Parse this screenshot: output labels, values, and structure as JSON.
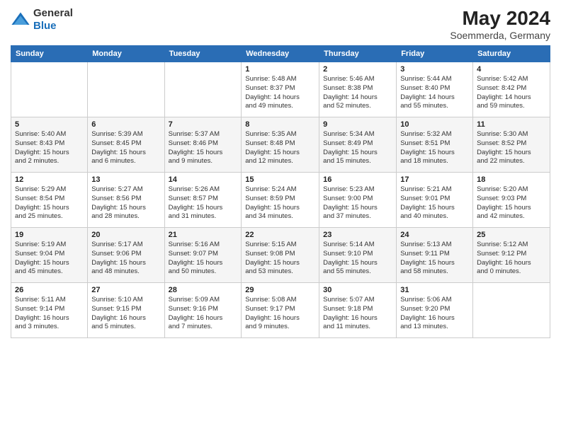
{
  "header": {
    "logo_general": "General",
    "logo_blue": "Blue",
    "main_title": "May 2024",
    "subtitle": "Soemmerda, Germany"
  },
  "weekdays": [
    "Sunday",
    "Monday",
    "Tuesday",
    "Wednesday",
    "Thursday",
    "Friday",
    "Saturday"
  ],
  "weeks": [
    [
      {
        "day": "",
        "info": ""
      },
      {
        "day": "",
        "info": ""
      },
      {
        "day": "",
        "info": ""
      },
      {
        "day": "1",
        "info": "Sunrise: 5:48 AM\nSunset: 8:37 PM\nDaylight: 14 hours\nand 49 minutes."
      },
      {
        "day": "2",
        "info": "Sunrise: 5:46 AM\nSunset: 8:38 PM\nDaylight: 14 hours\nand 52 minutes."
      },
      {
        "day": "3",
        "info": "Sunrise: 5:44 AM\nSunset: 8:40 PM\nDaylight: 14 hours\nand 55 minutes."
      },
      {
        "day": "4",
        "info": "Sunrise: 5:42 AM\nSunset: 8:42 PM\nDaylight: 14 hours\nand 59 minutes."
      }
    ],
    [
      {
        "day": "5",
        "info": "Sunrise: 5:40 AM\nSunset: 8:43 PM\nDaylight: 15 hours\nand 2 minutes."
      },
      {
        "day": "6",
        "info": "Sunrise: 5:39 AM\nSunset: 8:45 PM\nDaylight: 15 hours\nand 6 minutes."
      },
      {
        "day": "7",
        "info": "Sunrise: 5:37 AM\nSunset: 8:46 PM\nDaylight: 15 hours\nand 9 minutes."
      },
      {
        "day": "8",
        "info": "Sunrise: 5:35 AM\nSunset: 8:48 PM\nDaylight: 15 hours\nand 12 minutes."
      },
      {
        "day": "9",
        "info": "Sunrise: 5:34 AM\nSunset: 8:49 PM\nDaylight: 15 hours\nand 15 minutes."
      },
      {
        "day": "10",
        "info": "Sunrise: 5:32 AM\nSunset: 8:51 PM\nDaylight: 15 hours\nand 18 minutes."
      },
      {
        "day": "11",
        "info": "Sunrise: 5:30 AM\nSunset: 8:52 PM\nDaylight: 15 hours\nand 22 minutes."
      }
    ],
    [
      {
        "day": "12",
        "info": "Sunrise: 5:29 AM\nSunset: 8:54 PM\nDaylight: 15 hours\nand 25 minutes."
      },
      {
        "day": "13",
        "info": "Sunrise: 5:27 AM\nSunset: 8:56 PM\nDaylight: 15 hours\nand 28 minutes."
      },
      {
        "day": "14",
        "info": "Sunrise: 5:26 AM\nSunset: 8:57 PM\nDaylight: 15 hours\nand 31 minutes."
      },
      {
        "day": "15",
        "info": "Sunrise: 5:24 AM\nSunset: 8:59 PM\nDaylight: 15 hours\nand 34 minutes."
      },
      {
        "day": "16",
        "info": "Sunrise: 5:23 AM\nSunset: 9:00 PM\nDaylight: 15 hours\nand 37 minutes."
      },
      {
        "day": "17",
        "info": "Sunrise: 5:21 AM\nSunset: 9:01 PM\nDaylight: 15 hours\nand 40 minutes."
      },
      {
        "day": "18",
        "info": "Sunrise: 5:20 AM\nSunset: 9:03 PM\nDaylight: 15 hours\nand 42 minutes."
      }
    ],
    [
      {
        "day": "19",
        "info": "Sunrise: 5:19 AM\nSunset: 9:04 PM\nDaylight: 15 hours\nand 45 minutes."
      },
      {
        "day": "20",
        "info": "Sunrise: 5:17 AM\nSunset: 9:06 PM\nDaylight: 15 hours\nand 48 minutes."
      },
      {
        "day": "21",
        "info": "Sunrise: 5:16 AM\nSunset: 9:07 PM\nDaylight: 15 hours\nand 50 minutes."
      },
      {
        "day": "22",
        "info": "Sunrise: 5:15 AM\nSunset: 9:08 PM\nDaylight: 15 hours\nand 53 minutes."
      },
      {
        "day": "23",
        "info": "Sunrise: 5:14 AM\nSunset: 9:10 PM\nDaylight: 15 hours\nand 55 minutes."
      },
      {
        "day": "24",
        "info": "Sunrise: 5:13 AM\nSunset: 9:11 PM\nDaylight: 15 hours\nand 58 minutes."
      },
      {
        "day": "25",
        "info": "Sunrise: 5:12 AM\nSunset: 9:12 PM\nDaylight: 16 hours\nand 0 minutes."
      }
    ],
    [
      {
        "day": "26",
        "info": "Sunrise: 5:11 AM\nSunset: 9:14 PM\nDaylight: 16 hours\nand 3 minutes."
      },
      {
        "day": "27",
        "info": "Sunrise: 5:10 AM\nSunset: 9:15 PM\nDaylight: 16 hours\nand 5 minutes."
      },
      {
        "day": "28",
        "info": "Sunrise: 5:09 AM\nSunset: 9:16 PM\nDaylight: 16 hours\nand 7 minutes."
      },
      {
        "day": "29",
        "info": "Sunrise: 5:08 AM\nSunset: 9:17 PM\nDaylight: 16 hours\nand 9 minutes."
      },
      {
        "day": "30",
        "info": "Sunrise: 5:07 AM\nSunset: 9:18 PM\nDaylight: 16 hours\nand 11 minutes."
      },
      {
        "day": "31",
        "info": "Sunrise: 5:06 AM\nSunset: 9:20 PM\nDaylight: 16 hours\nand 13 minutes."
      },
      {
        "day": "",
        "info": ""
      }
    ]
  ]
}
